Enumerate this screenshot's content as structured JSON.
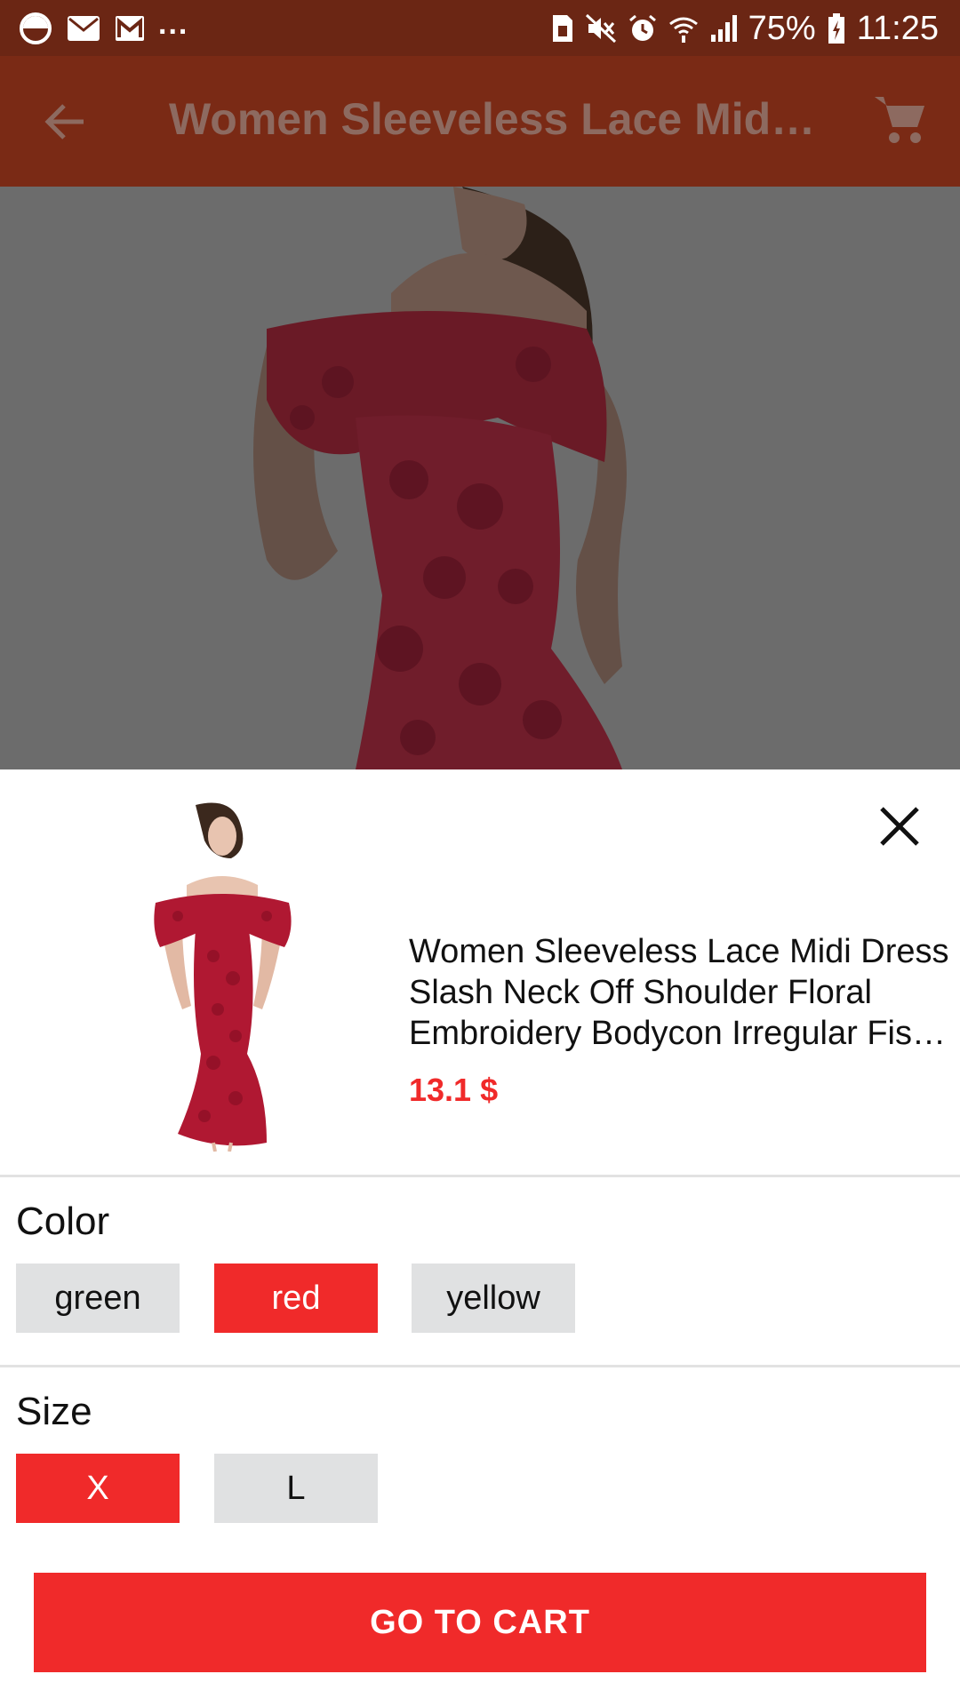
{
  "status_bar": {
    "more": "...",
    "battery": "75%",
    "time": "11:25"
  },
  "app_bar": {
    "title": "Women Sleeveless Lace Midi Dress Slash Neck Off Shoulder Floral Embroidery Bodycon Irregular Fishtail Dress"
  },
  "product": {
    "name_lines": [
      "Women Sleeveless Lace Midi Dress",
      "Slash Neck Off Shoulder Floral",
      "Embroidery Bodycon Irregular Fishtail Dress"
    ],
    "price": "13.1 $"
  },
  "color_section": {
    "title": "Color",
    "options": [
      "green",
      "red",
      "yellow"
    ],
    "selected": "red"
  },
  "size_section": {
    "title": "Size",
    "options": [
      "X",
      "L"
    ],
    "selected": "X"
  },
  "go_to_cart_label": "GO TO CART",
  "colors": {
    "status_bar": "#6b2614",
    "app_bar": "#7a2a15",
    "accent": "#f02a2a",
    "chip_bg": "#e0e1e2",
    "dress": "#b01832"
  }
}
